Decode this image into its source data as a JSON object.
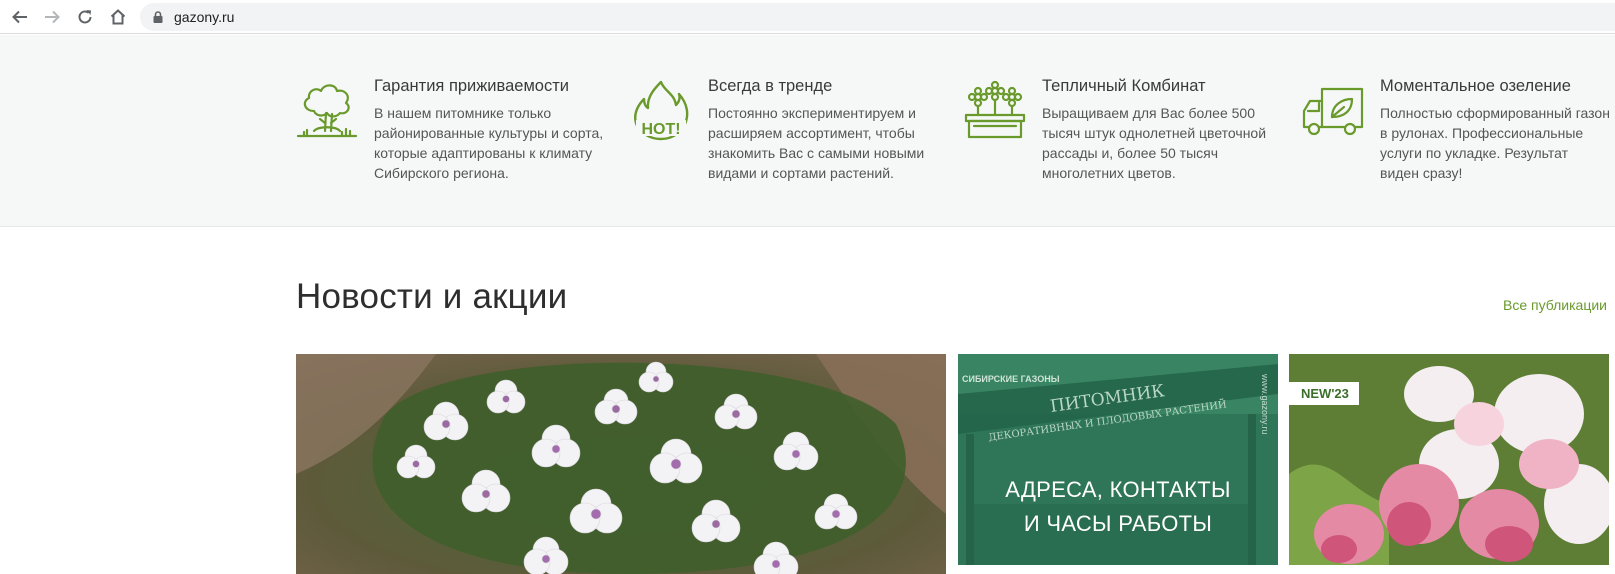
{
  "browser": {
    "url": "gazony.ru"
  },
  "features": [
    {
      "icon": "tree-icon",
      "title": "Гарантия приживаемости",
      "text": "В нашем питомнике только районированные культуры и сорта, которые адаптированы к климату Сибирского региона."
    },
    {
      "icon": "hot-flame-icon",
      "title": "Всегда в тренде",
      "text": "Постоянно экспериментируем и расширяем ассортимент, чтобы знакомить Вас с самыми новыми видами и сортами растений."
    },
    {
      "icon": "flower-box-icon",
      "title": "Тепличный Комбинат",
      "text": "Выращиваем для Вас более 500 тысяч штук однолетней цветочной рассады и, более 50 тысяч многолетних цветов."
    },
    {
      "icon": "delivery-truck-icon",
      "title": "Моментальное озеление",
      "text": "Полностью сформированный газон в рулонах. Профессиональные услуги по укладке. Результат виден сразу!"
    }
  ],
  "news": {
    "title": "Новости и акции",
    "all_link": "Все публикации",
    "cards": [
      {
        "image": "white-flowers-photo"
      },
      {
        "image": "nursery-gate-photo",
        "sign_line1": "ПИТОМНИК",
        "sign_line2": "ДЕКОРАТИВНЫХ И ПЛОДОВЫХ РАСТЕНИЙ",
        "logo_text": "СИБИРСКИЕ ГАЗОНЫ",
        "line1": "АДРЕСА, КОНТАКТЫ",
        "line2": "И ЧАСЫ РАБОТЫ",
        "watermark": "www.gazony.ru"
      },
      {
        "image": "hydrangea-photo",
        "badge": "NEW'23"
      }
    ]
  },
  "colors": {
    "accent": "#6b9a2e",
    "icon_green": "#6a9a2c",
    "band_bg": "#f6f8f8"
  }
}
